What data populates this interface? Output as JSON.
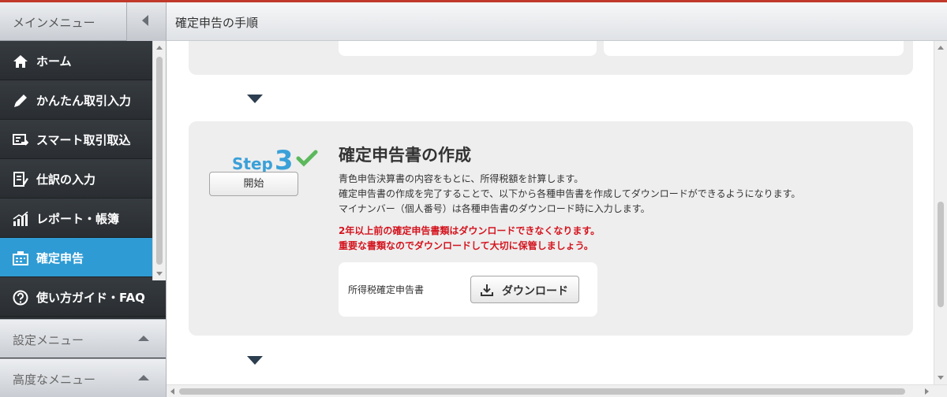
{
  "sidebar": {
    "title": "メインメニュー",
    "items": [
      {
        "label": "ホーム",
        "icon": "home-icon"
      },
      {
        "label": "かんたん取引入力",
        "icon": "pencil-icon"
      },
      {
        "label": "スマート取引取込",
        "icon": "import-icon"
      },
      {
        "label": "仕訳の入力",
        "icon": "journal-icon"
      },
      {
        "label": "レポート・帳簿",
        "icon": "report-chart-icon"
      },
      {
        "label": "確定申告",
        "icon": "tax-return-icon",
        "active": true
      },
      {
        "label": "使い方ガイド・FAQ",
        "icon": "help-icon"
      }
    ],
    "settings_menu": "設定メニュー",
    "advanced_menu": "高度なメニュー"
  },
  "main": {
    "title": "確定申告の手順",
    "step": {
      "word": "Step",
      "number": "3",
      "start_label": "開始",
      "title": "確定申告書の作成",
      "desc": [
        "青色申告決算書の内容をもとに、所得税額を計算します。",
        "確定申告書の作成を完了することで、以下から各種申告書を作成してダウンロードができるようになります。",
        "マイナンバー（個人番号）は各種申告書のダウンロード時に入力します。"
      ],
      "warnings": [
        "2年以上前の確定申告書類はダウンロードできなくなります。",
        "重要な書類なのでダウンロードして大切に保管しましょう。"
      ],
      "download_item_label": "所得税確定申告書",
      "download_label": "ダウンロード"
    }
  },
  "colors": {
    "accent": "#2f9bd4",
    "step_blue": "#3aa0d8",
    "check_green": "#5cb85c",
    "warning_red": "#d4141e",
    "top_bar": "#c0392b"
  }
}
